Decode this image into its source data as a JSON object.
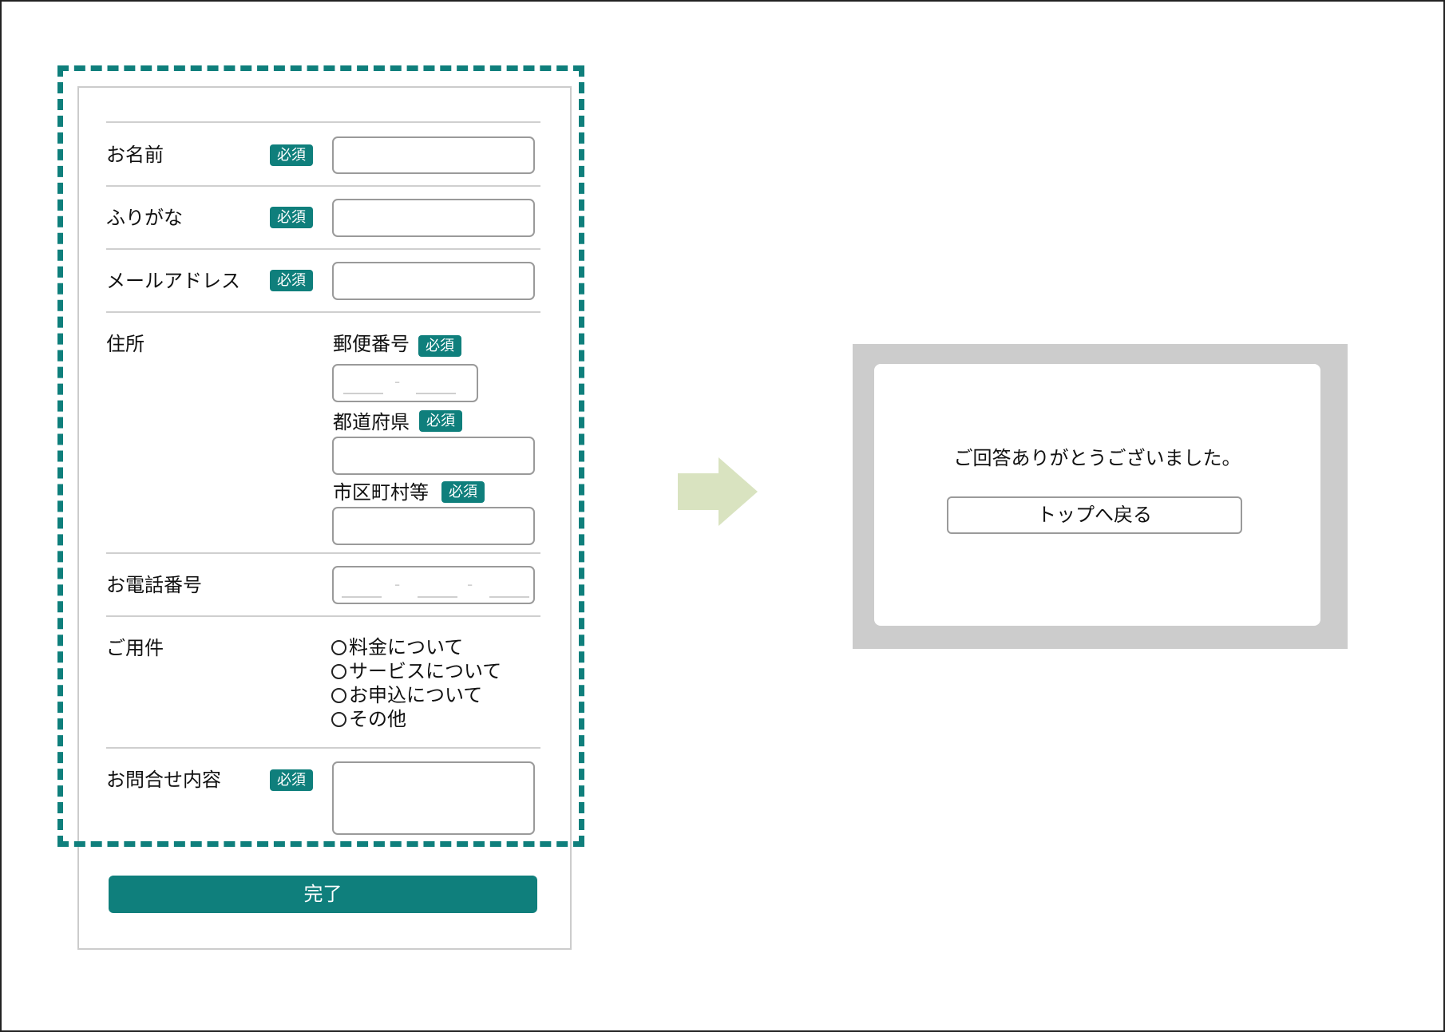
{
  "form": {
    "required_badge": "必須",
    "fields": {
      "name": "お名前",
      "furigana": "ふりがな",
      "email": "メールアドレス",
      "address": "住所",
      "phone": "お電話番号",
      "inquiry_type": "ご用件",
      "inquiry_content": "お問合せ内容"
    },
    "address": {
      "postal_code": "郵便番号",
      "prefecture": "都道府県",
      "city": "市区町村等",
      "separator": "-"
    },
    "inquiry_options": [
      "料金について",
      "サービスについて",
      "お申込について",
      "その他"
    ],
    "submit_label": "完了"
  },
  "completion": {
    "message": "ご回答ありがとうございました。",
    "back_button": "トップへ戻る"
  },
  "colors": {
    "accent": "#0f7f7c",
    "arrow": "#d9e3c0",
    "dialog_overlay": "#cccccc",
    "divider": "#cfcfcf"
  }
}
